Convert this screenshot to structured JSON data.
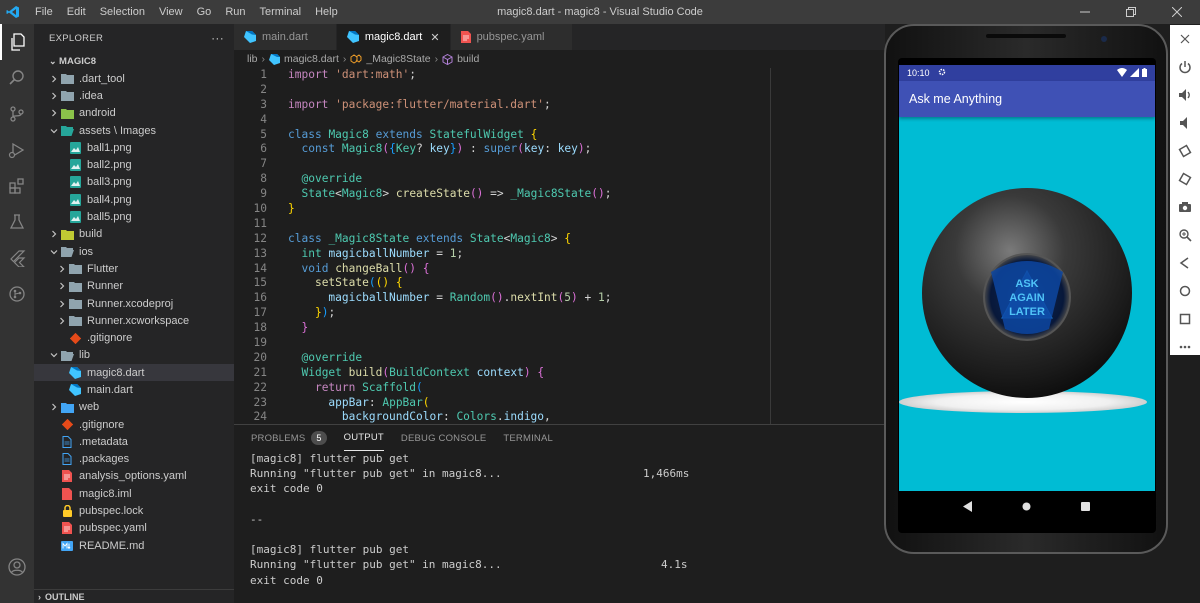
{
  "window": {
    "title": "magic8.dart - magic8 - Visual Studio Code",
    "menu": [
      "File",
      "Edit",
      "Selection",
      "View",
      "Go",
      "Run",
      "Terminal",
      "Help"
    ]
  },
  "sidebar": {
    "header": "EXPLORER",
    "more": "···",
    "root": "MAGIC8",
    "outline": "OUTLINE",
    "items": [
      {
        "label": ".dart_tool",
        "type": "folder",
        "level": 0,
        "expanded": false
      },
      {
        "label": ".idea",
        "type": "folder",
        "level": 0,
        "expanded": false
      },
      {
        "label": "android",
        "type": "folder-android",
        "level": 0,
        "expanded": false
      },
      {
        "label": "assets \\ Images",
        "type": "folder-assets",
        "level": 0,
        "expanded": true
      },
      {
        "label": "ball1.png",
        "type": "image",
        "level": 1
      },
      {
        "label": "ball2.png",
        "type": "image",
        "level": 1
      },
      {
        "label": "ball3.png",
        "type": "image",
        "level": 1
      },
      {
        "label": "ball4.png",
        "type": "image",
        "level": 1
      },
      {
        "label": "ball5.png",
        "type": "image",
        "level": 1
      },
      {
        "label": "build",
        "type": "folder-build",
        "level": 0,
        "expanded": false
      },
      {
        "label": "ios",
        "type": "folder-open",
        "level": 0,
        "expanded": true
      },
      {
        "label": "Flutter",
        "type": "folder",
        "level": 1,
        "expanded": false
      },
      {
        "label": "Runner",
        "type": "folder",
        "level": 1,
        "expanded": false
      },
      {
        "label": "Runner.xcodeproj",
        "type": "folder",
        "level": 1,
        "expanded": false
      },
      {
        "label": "Runner.xcworkspace",
        "type": "folder",
        "level": 1,
        "expanded": false
      },
      {
        "label": ".gitignore",
        "type": "git",
        "level": 1
      },
      {
        "label": "lib",
        "type": "folder-open",
        "level": 0,
        "expanded": true
      },
      {
        "label": "magic8.dart",
        "type": "dart",
        "level": 1,
        "selected": true
      },
      {
        "label": "main.dart",
        "type": "dart",
        "level": 1
      },
      {
        "label": "web",
        "type": "folder-web",
        "level": 0,
        "expanded": false
      },
      {
        "label": ".gitignore",
        "type": "git",
        "level": 0
      },
      {
        "label": ".metadata",
        "type": "file",
        "level": 0
      },
      {
        "label": ".packages",
        "type": "file",
        "level": 0
      },
      {
        "label": "analysis_options.yaml",
        "type": "yaml",
        "level": 0
      },
      {
        "label": "magic8.iml",
        "type": "iml",
        "level": 0
      },
      {
        "label": "pubspec.lock",
        "type": "lock",
        "level": 0
      },
      {
        "label": "pubspec.yaml",
        "type": "yaml",
        "level": 0
      },
      {
        "label": "README.md",
        "type": "md",
        "level": 0
      }
    ]
  },
  "tabs": [
    {
      "label": "main.dart",
      "icon": "dart-icon",
      "active": false
    },
    {
      "label": "magic8.dart",
      "icon": "dart-icon",
      "active": true,
      "close": "✕"
    },
    {
      "label": "pubspec.yaml",
      "icon": "yaml-icon",
      "active": false
    }
  ],
  "breadcrumb": {
    "folder": "lib",
    "file": "magic8.dart",
    "class": "_Magic8State",
    "method": "build"
  },
  "code_lines": [
    {
      "n": "1",
      "html": "<span class='ctl'>import</span> <span class='s'>'dart:math'</span><span class='p'>;</span>"
    },
    {
      "n": "2",
      "html": ""
    },
    {
      "n": "3",
      "html": "<span class='ctl'>import</span> <span class='s'>'package:flutter/material.dart'</span><span class='p'>;</span>"
    },
    {
      "n": "4",
      "html": ""
    },
    {
      "n": "5",
      "html": "<span class='k'>class</span> <span class='c'>Magic8</span> <span class='k'>extends</span> <span class='c'>StatefulWidget</span> <span class='y'>{</span>"
    },
    {
      "n": "6",
      "html": "  <span class='k'>const</span> <span class='c'>Magic8</span><span class='pk'>(</span><span class='bl'>{</span><span class='c'>Key</span><span class='p'>?</span> <span class='v'>key</span><span class='bl'>}</span><span class='pk'>)</span> <span class='p'>:</span> <span class='k'>super</span><span class='pk'>(</span><span class='v'>key</span><span class='p'>:</span> <span class='v'>key</span><span class='pk'>)</span><span class='p'>;</span>"
    },
    {
      "n": "7",
      "html": ""
    },
    {
      "n": "8",
      "html": "  <span class='c'>@override</span>"
    },
    {
      "n": "9",
      "html": "  <span class='c'>State</span><span class='p'>&lt;</span><span class='c'>Magic8</span><span class='p'>&gt;</span> <span class='f'>createState</span><span class='pk'>()</span> <span class='p'>=&gt;</span> <span class='c'>_Magic8State</span><span class='pk'>()</span><span class='p'>;</span>"
    },
    {
      "n": "10",
      "html": "<span class='y'>}</span>"
    },
    {
      "n": "11",
      "html": ""
    },
    {
      "n": "12",
      "html": "<span class='k'>class</span> <span class='c'>_Magic8State</span> <span class='k'>extends</span> <span class='c'>State</span><span class='p'>&lt;</span><span class='c'>Magic8</span><span class='p'>&gt;</span> <span class='y'>{</span>"
    },
    {
      "n": "13",
      "html": "  <span class='c'>int</span> <span class='v'>magicballNumber</span> <span class='p'>=</span> <span class='n'>1</span><span class='p'>;</span>"
    },
    {
      "n": "14",
      "html": "  <span class='k'>void</span> <span class='f'>changeBall</span><span class='pk'>()</span> <span class='pk'>{</span>"
    },
    {
      "n": "15",
      "html": "    <span class='f'>setState</span><span class='bl'>(</span><span class='y'>()</span> <span class='y'>{</span>"
    },
    {
      "n": "16",
      "html": "      <span class='v'>magicballNumber</span> <span class='p'>=</span> <span class='c'>Random</span><span class='pk'>()</span><span class='p'>.</span><span class='f'>nextInt</span><span class='pk'>(</span><span class='n'>5</span><span class='pk'>)</span> <span class='p'>+</span> <span class='n'>1</span><span class='p'>;</span>"
    },
    {
      "n": "17",
      "html": "    <span class='y'>}</span><span class='bl'>)</span><span class='p'>;</span>"
    },
    {
      "n": "18",
      "html": "  <span class='pk'>}</span>"
    },
    {
      "n": "19",
      "html": ""
    },
    {
      "n": "20",
      "html": "  <span class='c'>@override</span>"
    },
    {
      "n": "21",
      "html": "  <span class='c'>Widget</span> <span class='f'>build</span><span class='pk'>(</span><span class='c'>BuildContext</span> <span class='v'>context</span><span class='pk'>)</span> <span class='pk'>{</span>"
    },
    {
      "n": "22",
      "html": "    <span class='ctl'>return</span> <span class='c'>Scaffold</span><span class='bl'>(</span>"
    },
    {
      "n": "23",
      "html": "      <span class='v'>appBar</span><span class='p'>:</span> <span class='c'>AppBar</span><span class='y'>(</span>"
    },
    {
      "n": "24",
      "html": "        <span class='v'>backgroundColor</span><span class='p'>:</span> <span class='c'>Colors</span><span class='p'>.</span><span class='v'>indigo</span><span class='p'>,</span>"
    }
  ],
  "panel": {
    "tabs": [
      {
        "label": "PROBLEMS",
        "badge": "5",
        "active": false
      },
      {
        "label": "OUTPUT",
        "active": true
      },
      {
        "label": "DEBUG CONSOLE",
        "active": false
      },
      {
        "label": "TERMINAL",
        "active": false
      }
    ],
    "output_lines": [
      {
        "text": "[magic8] flutter pub get",
        "time": ""
      },
      {
        "text": "Running \"flutter pub get\" in magic8...",
        "time": "1,466ms",
        "time_col": 393
      },
      {
        "text": "exit code 0",
        "time": ""
      },
      {
        "text": "",
        "time": ""
      },
      {
        "text": "--",
        "time": ""
      },
      {
        "text": "",
        "time": ""
      },
      {
        "text": "[magic8] flutter pub get",
        "time": ""
      },
      {
        "text": "Running \"flutter pub get\" in magic8...",
        "time": "4.1s",
        "time_col": 411
      },
      {
        "text": "exit code 0",
        "time": ""
      }
    ]
  },
  "emulator": {
    "status_time": "10:10",
    "app_title": "Ask me Anything",
    "ball_text": [
      "ASK",
      "AGAIN",
      "LATER"
    ],
    "screen_color": "#00bcd4",
    "appbar_color": "#3f51b5",
    "statusbar_color": "#303f9f"
  }
}
